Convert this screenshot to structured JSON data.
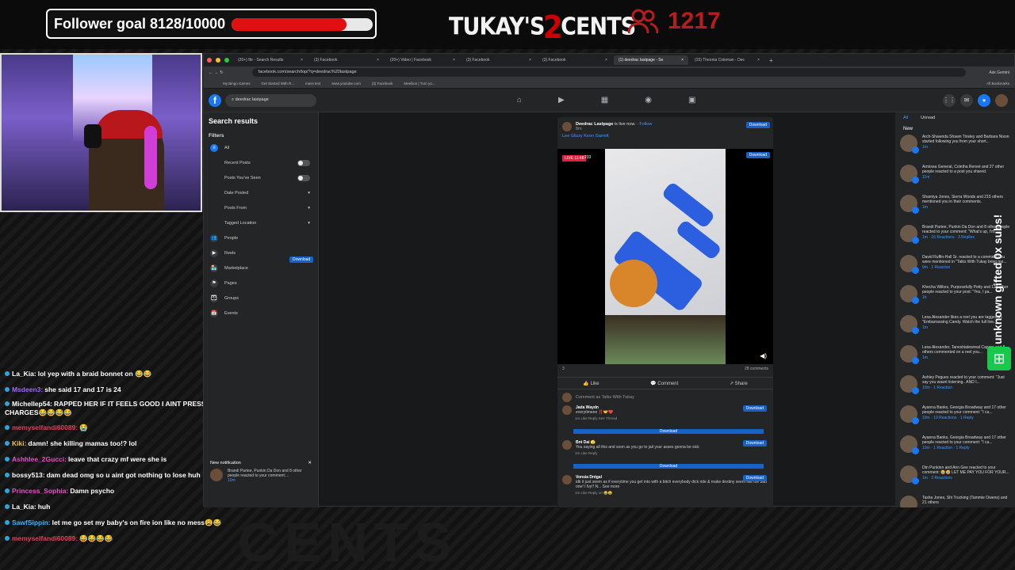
{
  "overlay": {
    "follower_goal_label": "Follower goal 8128/10000",
    "follower_goal_progress": 0.8128,
    "brand_left": "TUKAY'S",
    "brand_num": "2",
    "brand_right": "CENTS",
    "follower_count": "1217",
    "side_text": "unknown gifted 0x subs!",
    "accent_red": "#e01010"
  },
  "chat": [
    {
      "name": "La_Kia:",
      "color": "#ffffff",
      "text": "lol yep with a braid bonnet on 😂😂"
    },
    {
      "name": "Msdeen3:",
      "color": "#a066ff",
      "text": "she said 17 and 17 is 24"
    },
    {
      "name": "Michellep54:",
      "color": "#ffffff",
      "text": "RAPPED HER IF IT FEELS GOOD I AINT PRESSING CHARGES😂😂😂😂",
      "wrap": true
    },
    {
      "name": "memyselfandi60089:",
      "color": "#e0405a",
      "text": "😭"
    },
    {
      "name": "Kiki:",
      "color": "#f0c040",
      "text": "damn! she killing mamas too!? lol"
    },
    {
      "name": "Ashhlee_2Gucci:",
      "color": "#e84fc8",
      "text": "leave that crazy mf were she is"
    },
    {
      "name": "bossy513:",
      "color": "#ffffff",
      "text": "dam dead omg so u aint got nothing to lose huh"
    },
    {
      "name": "Princess_Sophia:",
      "color": "#e84fc8",
      "text": "Damn psycho"
    },
    {
      "name": "La_Kia:",
      "color": "#ffffff",
      "text": "huh"
    },
    {
      "name": "SawfSippin:",
      "color": "#3ab4ff",
      "text": "let me go set my baby's on fire ion like no mess😩😂"
    },
    {
      "name": "memyselfandi60089:",
      "color": "#e0405a",
      "text": "😂😂😂😂"
    }
  ],
  "browser": {
    "tabs": [
      {
        "label": "(20+) fbr - Search Results",
        "active": false
      },
      {
        "label": "(3) Facebook",
        "active": false
      },
      {
        "label": "(20+) Video | Facebook",
        "active": false
      },
      {
        "label": "(3) Facebook",
        "active": false
      },
      {
        "label": "(3) Facebook",
        "active": false
      },
      {
        "label": "(1) deedrac lastpage - Se",
        "active": true
      },
      {
        "label": "(15) Theonia Coleman - Dec",
        "active": false
      }
    ],
    "new_tab": "+",
    "ask_gemini": "Ask Gemini",
    "url": "facebook.com/search/top/?q=deedrac%20lastpage",
    "bookmarks": [
      "My Bingo Games",
      "Get Started With R...",
      "mass text",
      "www.youtube.com",
      "(3) Facebook",
      "Meeliion | Turn yo..."
    ],
    "all_bookmarks": "All Bookmarks"
  },
  "facebook": {
    "search_value": "deedrac lastpage",
    "left": {
      "title": "Search results",
      "filters_label": "Filters",
      "items": [
        "All"
      ],
      "sub_filters": [
        {
          "label": "Recent Posts",
          "control": "toggle"
        },
        {
          "label": "Posts You've Seen",
          "control": "toggle"
        },
        {
          "label": "Date Posted",
          "control": "caret"
        },
        {
          "label": "Posts From",
          "control": "caret"
        },
        {
          "label": "Tagged Location",
          "control": "caret"
        }
      ],
      "categories": [
        "People",
        "Reels",
        "Marketplace",
        "Pages",
        "Groups",
        "Events"
      ],
      "notification_title": "New notification",
      "notification_text": "Brandi Partee, Punkin Da Don and 8 other people reacted to your comment:...",
      "notification_time": "10m"
    },
    "download": "Download",
    "post": {
      "author": "Deedrac Lastpage",
      "status": "is live now.",
      "follow": "Follow",
      "time": "8m",
      "subtitle": "Lee Glizzy Keon Garrett",
      "live_badge": "LIVE 11:48",
      "viewers": "233",
      "comments_count": "28 comments",
      "reactions": "3",
      "like": "Like",
      "comment": "Comment",
      "share": "Share",
      "comment_placeholder": "Comment as Talks With Tukay",
      "comments": [
        {
          "name": "Jada Waydn",
          "text": "everytimeee ‼️🤝❤️",
          "meta": "1m  Like  Reply  See Thread"
        },
        {
          "name": "Bnt Dai 🫣",
          "text": "You saying all this and soon as you go to jail your asses gonna be sick",
          "meta": "1m  Like  Reply"
        },
        {
          "name": "Vonsia Dntgal",
          "text": "idk it just seem as if everytime you get into with a bitch everybody dick ride & make destiny seem like the bad one! I fvy!! N... See more",
          "meta": "1m  Like  Reply  10 😂😮"
        }
      ]
    },
    "notifs": {
      "tabs": [
        "All",
        "Unread"
      ],
      "new_label": "New",
      "items": [
        {
          "text": "Arch-Shawnda Shawn Tinsley and Barbara Nixon started following you from your short...",
          "time": "1m"
        },
        {
          "text": "Armisea General, Coletha Reneé and 27 other people reacted to a post you shared.",
          "time": "11m"
        },
        {
          "text": "Shamiya Jones, Sierra Woods and 215 others mentioned you in their comments.",
          "time": "1m"
        },
        {
          "text": "Brandi Partee, Punkin Da Don and 8 other people reacted to your comment: \"What's up, I'm...",
          "time": "1m · 16 Reactions · 3 Replies"
        },
        {
          "text": "David Ruffin-Hall Sr. reacted to a comment you were mentioned in \"Talks With Tukay bring me...",
          "time": "9m · 1 Reaction"
        },
        {
          "text": "Khecha Wilkes, Purposefully Petty and 129 other people reacted to your post: \"Yes, I pa...",
          "time": "1h"
        },
        {
          "text": "Lesa Alexander likes a reel you are tagged in: \"Embarrassing Candy. Watch the full live...",
          "time": "1m"
        },
        {
          "text": "Lesa Alexander, Taneshiatewreal Capers and 8 others commented on a reel you...",
          "time": "1m"
        },
        {
          "text": "Ashley Pegues reacted to your comment: \"Just say you wasnt listening.. AND I...",
          "time": "10m · 1 Reaction"
        },
        {
          "text": "Ayanna Banks, Georgia Broadway and 17 other people reacted to your comment: \"I ca...",
          "time": "10m · 19 Reactions · 1 Reply"
        },
        {
          "text": "Ayanna Banks, Georgia Broadway and 17 other people reacted to your comment: \"I ca...",
          "time": "10m · 1 Reaction · 1 Reply"
        },
        {
          "text": "Dtn Punkinn and Ann Gee reacted to your comment: 🥹🥹 LET ME PAY YOU FOR YOUR...",
          "time": "1m · 2 Reactions"
        },
        {
          "text": "Tasha Jones, Shi Trucking (Tammie Owens) and 21 others",
          "time": ""
        }
      ]
    }
  }
}
